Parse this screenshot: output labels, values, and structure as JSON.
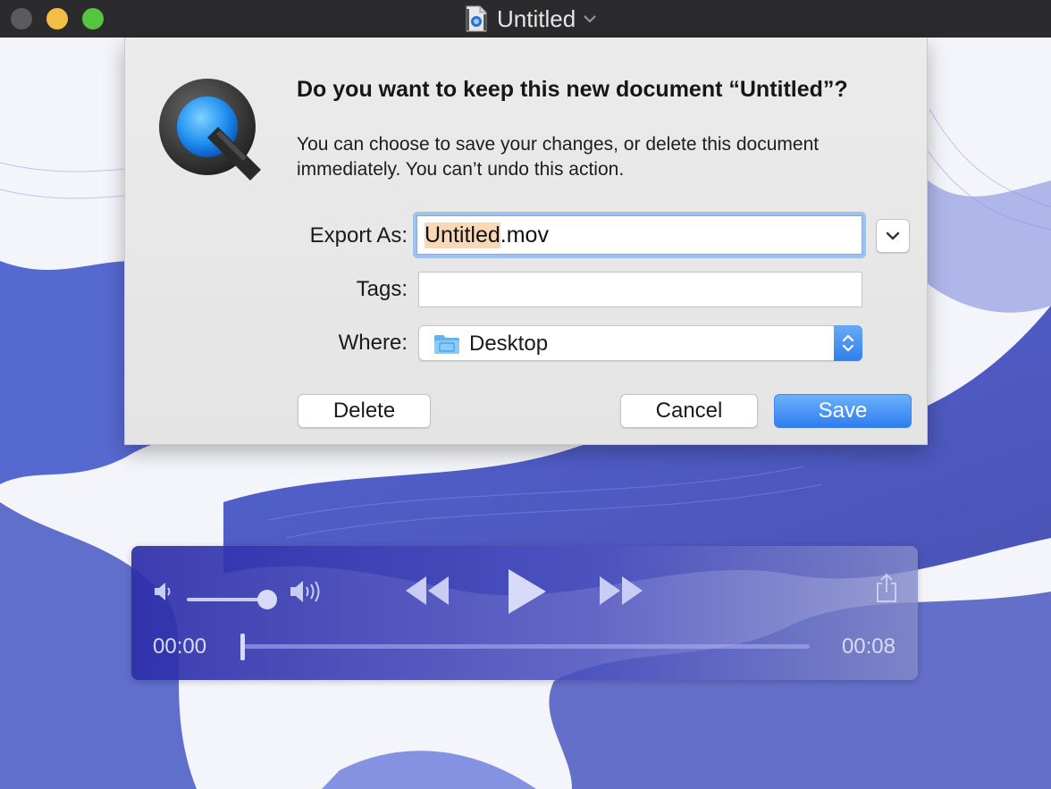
{
  "window": {
    "title": "Untitled",
    "controls": [
      "close",
      "minimize",
      "zoom"
    ]
  },
  "dialog": {
    "heading": "Do you want to keep this new document “Untitled”?",
    "message": "You can choose to save your changes, or delete this document immediately. You can’t undo this action.",
    "export_as": {
      "label": "Export As:",
      "value_selected": "Untitled",
      "value_rest": ".mov"
    },
    "tags": {
      "label": "Tags:",
      "value": ""
    },
    "where": {
      "label": "Where:",
      "value": "Desktop"
    },
    "buttons": {
      "delete": "Delete",
      "cancel": "Cancel",
      "save": "Save"
    }
  },
  "player": {
    "current_time": "00:00",
    "duration": "00:08",
    "volume": 0.8,
    "progress": 0.0
  },
  "colors": {
    "accent": "#3a86f2",
    "hud": "#3a3db0",
    "selection": "#f9d8b7"
  }
}
